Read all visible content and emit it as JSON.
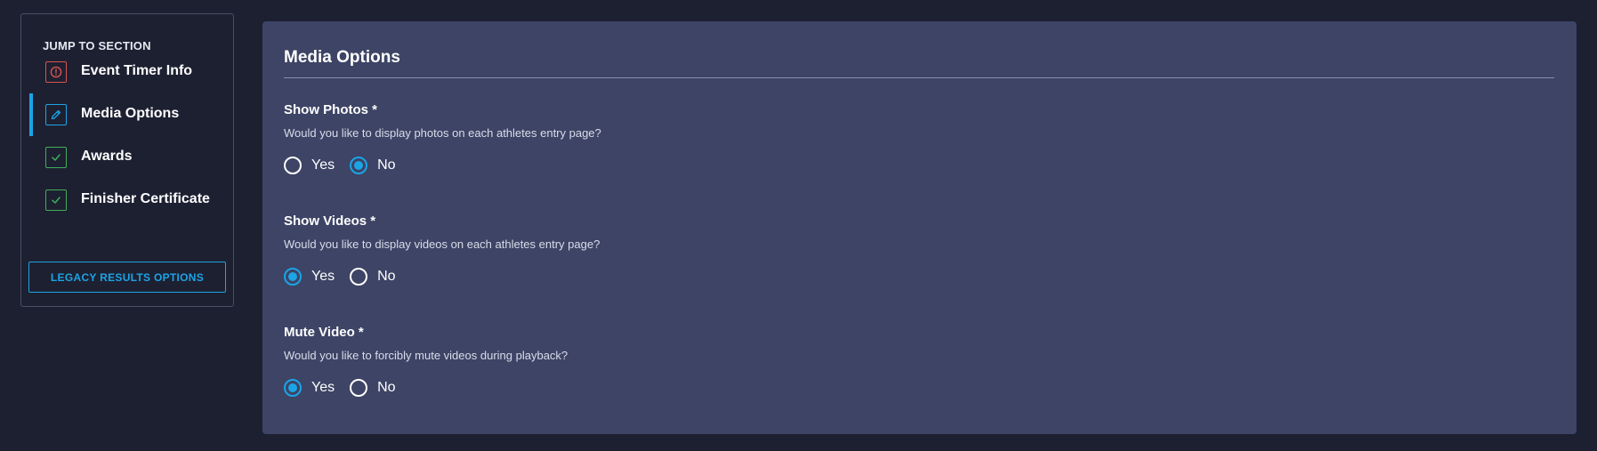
{
  "sidebar": {
    "heading": "JUMP TO SECTION",
    "items": [
      {
        "label": "Event Timer Info",
        "icon": "alert-circle-icon",
        "status": "error"
      },
      {
        "label": "Media Options",
        "icon": "pencil-icon",
        "status": "active"
      },
      {
        "label": "Awards",
        "icon": "check-icon",
        "status": "complete"
      },
      {
        "label": "Finisher Certificate",
        "icon": "check-icon",
        "status": "complete"
      }
    ],
    "legacy_button_label": "LEGACY RESULTS OPTIONS"
  },
  "main": {
    "title": "Media Options",
    "fields": [
      {
        "label": "Show Photos *",
        "help": "Would you like to display photos on each athletes entry page?",
        "options": [
          "Yes",
          "No"
        ],
        "selected": "No"
      },
      {
        "label": "Show Videos *",
        "help": "Would you like to display videos on each athletes entry page?",
        "options": [
          "Yes",
          "No"
        ],
        "selected": "Yes"
      },
      {
        "label": "Mute Video *",
        "help": "Would you like to forcibly mute videos during playback?",
        "options": [
          "Yes",
          "No"
        ],
        "selected": "Yes"
      }
    ]
  },
  "colors": {
    "background": "#1d2031",
    "panel": "#3d4465",
    "accent": "#1ba4e6",
    "error": "#d9534f",
    "success": "#3fae5a"
  }
}
